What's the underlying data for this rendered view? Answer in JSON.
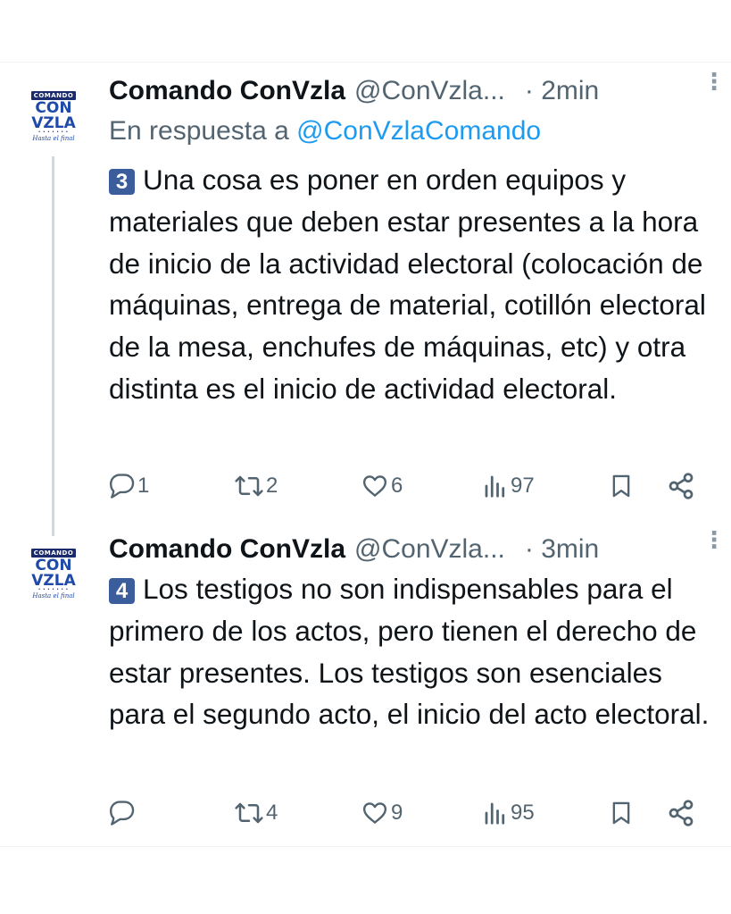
{
  "tweets": [
    {
      "author_name": "Comando ConVzla",
      "handle": "@ConVzla...",
      "time": "· 2min",
      "reply_prefix": "En respuesta a ",
      "reply_handle": "@ConVzlaComando",
      "number_badge": "3",
      "text": "Una cosa es poner en orden equipos y materiales que deben estar presentes a la hora de inicio de la actividad electoral (colocación de máquinas, entrega de material, cotillón electoral de la mesa, enchufes de máquinas, etc) y otra distinta es el inicio de actividad electoral.",
      "replies": "1",
      "retweets": "2",
      "likes": "6",
      "views": "97"
    },
    {
      "author_name": "Comando ConVzla",
      "handle": "@ConVzla...",
      "time": "· 3min",
      "number_badge": "4",
      "text": "Los testigos no son indispensables para el primero de los actos, pero tienen el derecho de estar presentes. Los testigos son esenciales para el segundo acto, el inicio del acto electoral.",
      "replies": "",
      "retweets": "4",
      "likes": "9",
      "views": "95"
    }
  ],
  "avatar": {
    "top": "COMANDO",
    "line1": "CON",
    "line2": "VZLA",
    "dots": "• • • • • • •",
    "tagline": "Hasta el final"
  },
  "icons": {
    "reply": "reply-icon",
    "retweet": "retweet-icon",
    "like": "heart-icon",
    "views": "views-icon",
    "bookmark": "bookmark-icon",
    "share": "share-icon",
    "more": "more-icon"
  },
  "colors": {
    "link": "#1d9bf0",
    "secondary_text": "#536471",
    "badge": "#3b5d9c",
    "brand": "#1a2a6c"
  }
}
